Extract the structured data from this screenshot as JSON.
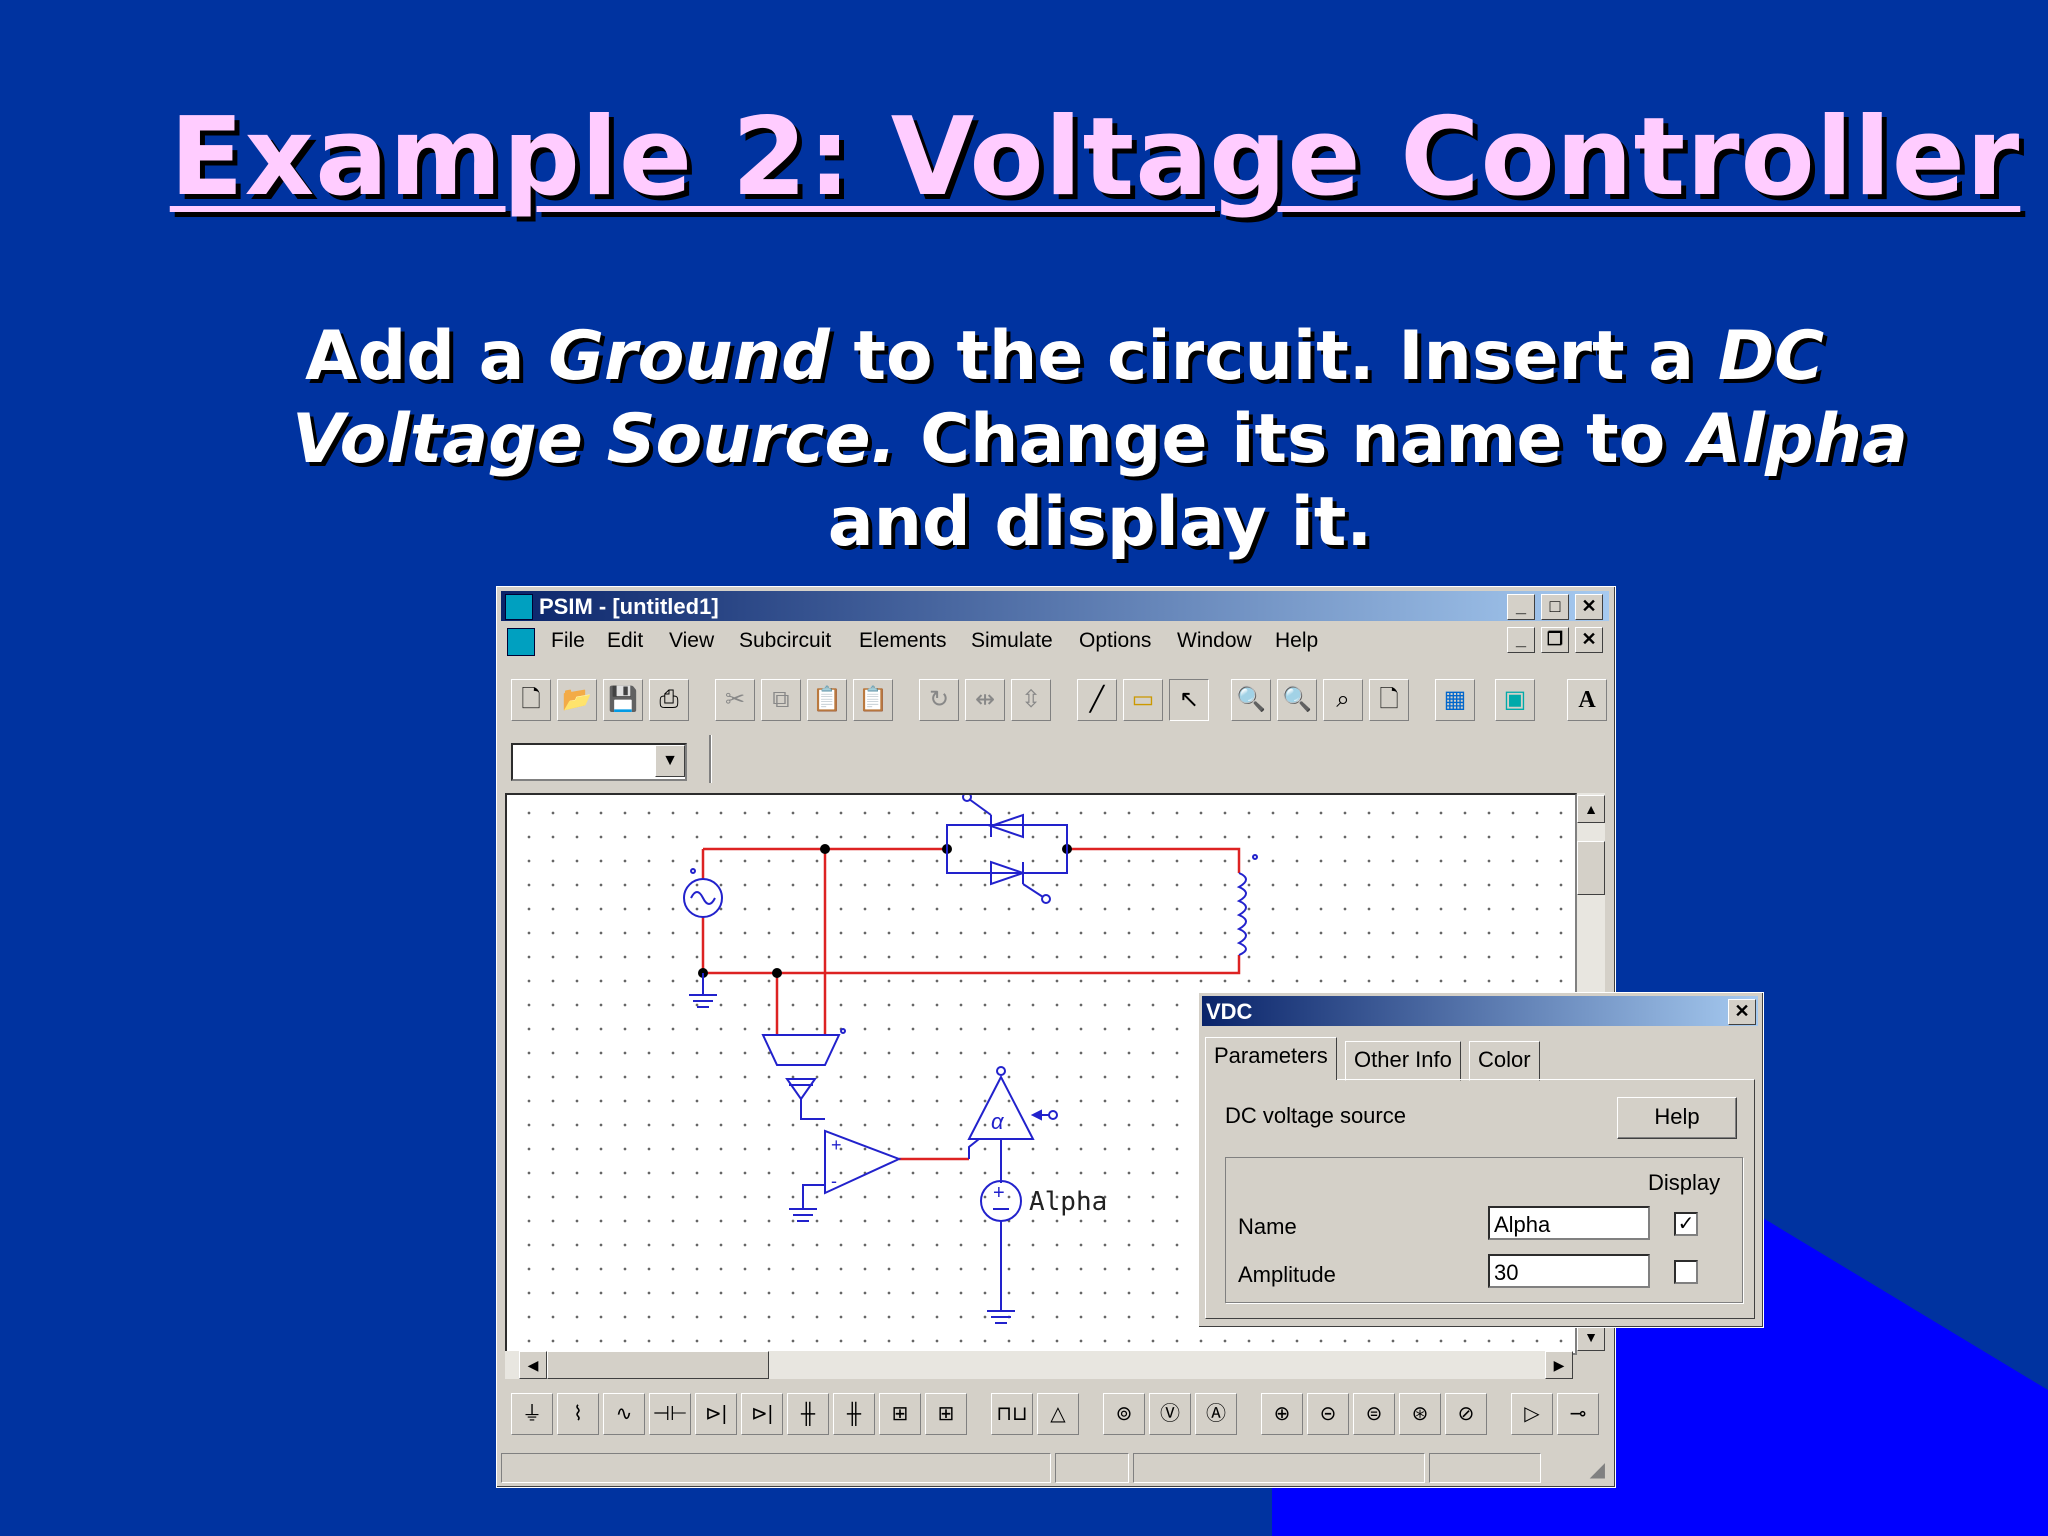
{
  "slide": {
    "title": "Example 2: Voltage Controller",
    "body": {
      "t1": "Add a ",
      "i1": "Ground",
      "t2": " to the circuit. Insert a ",
      "i2": "DC",
      "i3": "Voltage Source.",
      "t3": " Change its name to ",
      "i4": "Alpha",
      "t4": "and display it."
    }
  },
  "psim": {
    "title": "PSIM - [untitled1]",
    "menu": [
      "File",
      "Edit",
      "View",
      "Subcircuit",
      "Elements",
      "Simulate",
      "Options",
      "Window",
      "Help"
    ],
    "component_label": "Alpha",
    "toolbar_text_button": "A"
  },
  "dialog": {
    "title": "VDC",
    "tabs": [
      "Parameters",
      "Other Info",
      "Color"
    ],
    "description": "DC voltage source",
    "help_label": "Help",
    "display_label": "Display",
    "params": [
      {
        "label": "Name",
        "value": "Alpha",
        "display": true
      },
      {
        "label": "Amplitude",
        "value": "30",
        "display": false
      }
    ]
  },
  "colors": {
    "background": "#0033a0",
    "accent_corner": "#0000ff",
    "title": "#ffccff",
    "wire_red": "#dd2222",
    "component_blue": "#2222cc"
  }
}
